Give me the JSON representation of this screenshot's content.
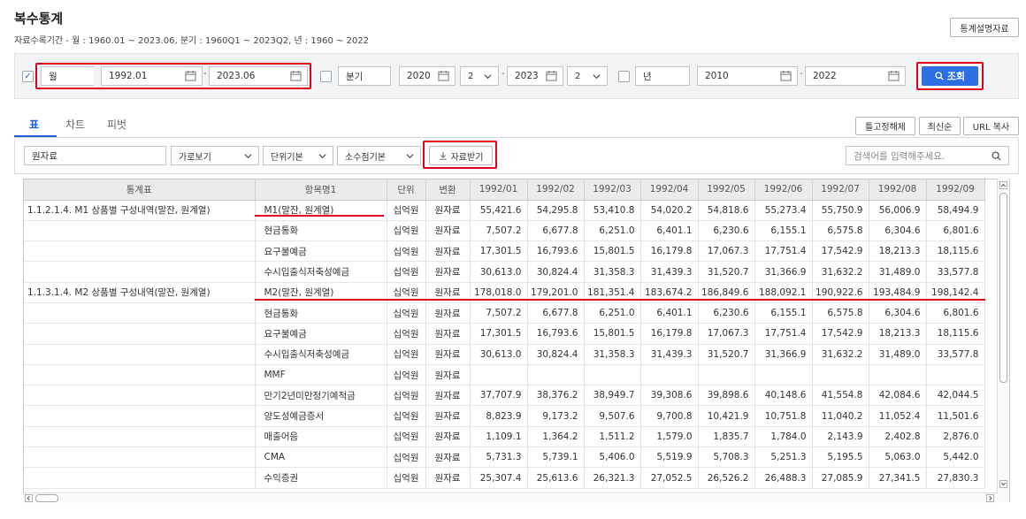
{
  "page": {
    "title": "복수통계",
    "subtitle": "자료수록기간 - 월 : 1960.01 ~ 2023.06, 분기 : 1960Q1 ~ 2023Q2, 년 : 1960 ~ 2022",
    "help_button": "통계설명자료"
  },
  "search": {
    "monthly": {
      "label": "월",
      "checked": true,
      "from": "1992.01",
      "to": "2023.06"
    },
    "quarterly": {
      "label": "분기",
      "checked": false,
      "from_year": "2020",
      "from_q": "2",
      "to_year": "2023",
      "to_q": "2"
    },
    "yearly": {
      "label": "년",
      "checked": false,
      "from": "2010",
      "to": "2022"
    },
    "dash": "-",
    "search_button": "조회"
  },
  "tabs": [
    {
      "label": "표",
      "active": true
    },
    {
      "label": "차트",
      "active": false
    },
    {
      "label": "피벗",
      "active": false
    }
  ],
  "top_actions": {
    "unfreeze": "틀고정해제",
    "latest": "최신순",
    "url_copy": "URL 복사"
  },
  "toolbar": {
    "raw_data": "원자료",
    "view": "가로보기",
    "unit": "단위기본",
    "decimal": "소수점기본",
    "download": "자료받기",
    "search_placeholder": "검색어를 입력해주세요."
  },
  "table": {
    "columns": [
      "통계표",
      "항목명1",
      "단위",
      "변환",
      "1992/01",
      "1992/02",
      "1992/03",
      "1992/04",
      "1992/05",
      "1992/06",
      "1992/07",
      "1992/08",
      "1992/09"
    ],
    "rows": [
      {
        "table": "1.1.2.1.4. M1 상품별 구성내역(말잔, 원계열)",
        "item": "M1(말잔, 원계열)",
        "unit": "십억원",
        "conv": "원자료",
        "values": [
          "55,421.6",
          "54,295.8",
          "53,410.8",
          "54,020.2",
          "54,818.6",
          "55,273.4",
          "55,750.9",
          "56,006.9",
          "58,494.9"
        ]
      },
      {
        "table": "",
        "item": "현금통화",
        "unit": "십억원",
        "conv": "원자료",
        "values": [
          "7,507.2",
          "6,677.8",
          "6,251.0",
          "6,401.1",
          "6,230.6",
          "6,155.1",
          "6,575.8",
          "6,304.6",
          "6,801.6"
        ]
      },
      {
        "table": "",
        "item": "요구불예금",
        "unit": "십억원",
        "conv": "원자료",
        "values": [
          "17,301.5",
          "16,793.6",
          "15,801.5",
          "16,179.8",
          "17,067.3",
          "17,751.4",
          "17,542.9",
          "18,213.3",
          "18,115.6"
        ]
      },
      {
        "table": "",
        "item": "수시입출식저축성예금",
        "unit": "십억원",
        "conv": "원자료",
        "values": [
          "30,613.0",
          "30,824.4",
          "31,358.3",
          "31,439.3",
          "31,520.7",
          "31,366.9",
          "31,632.2",
          "31,489.0",
          "33,577.8"
        ]
      },
      {
        "table": "1.1.3.1.4. M2 상품별 구성내역(말잔, 원계열)",
        "item": "M2(말잔, 원계열)",
        "unit": "십억원",
        "conv": "원자료",
        "values": [
          "178,018.0",
          "179,201.0",
          "181,351.4",
          "183,674.2",
          "186,849.6",
          "188,092.1",
          "190,922.6",
          "193,484.9",
          "198,142.4"
        ]
      },
      {
        "table": "",
        "item": "현금통화",
        "unit": "십억원",
        "conv": "원자료",
        "values": [
          "7,507.2",
          "6,677.8",
          "6,251.0",
          "6,401.1",
          "6,230.6",
          "6,155.1",
          "6,575.8",
          "6,304.6",
          "6,801.6"
        ]
      },
      {
        "table": "",
        "item": "요구불예금",
        "unit": "십억원",
        "conv": "원자료",
        "values": [
          "17,301.5",
          "16,793.6",
          "15,801.5",
          "16,179.8",
          "17,067.3",
          "17,751.4",
          "17,542.9",
          "18,213.3",
          "18,115.6"
        ]
      },
      {
        "table": "",
        "item": "수시입출식저축성예금",
        "unit": "십억원",
        "conv": "원자료",
        "values": [
          "30,613.0",
          "30,824.4",
          "31,358.3",
          "31,439.3",
          "31,520.7",
          "31,366.9",
          "31,632.2",
          "31,489.0",
          "33,577.8"
        ]
      },
      {
        "table": "",
        "item": "MMF",
        "unit": "십억원",
        "conv": "원자료",
        "values": [
          "",
          "",
          "",
          "",
          "",
          "",
          "",
          "",
          ""
        ]
      },
      {
        "table": "",
        "item": "만기2년미만정기예적금",
        "unit": "십억원",
        "conv": "원자료",
        "values": [
          "37,707.9",
          "38,376.2",
          "38,949.7",
          "39,308.6",
          "39,898.6",
          "40,148.6",
          "41,554.8",
          "42,084.6",
          "42,044.5"
        ]
      },
      {
        "table": "",
        "item": "양도성예금증서",
        "unit": "십억원",
        "conv": "원자료",
        "values": [
          "8,823.9",
          "9,173.2",
          "9,507.6",
          "9,700.8",
          "10,421.9",
          "10,751.8",
          "11,040.2",
          "11,052.4",
          "11,501.6"
        ]
      },
      {
        "table": "",
        "item": "매출어음",
        "unit": "십억원",
        "conv": "원자료",
        "values": [
          "1,109.1",
          "1,364.2",
          "1,511.2",
          "1,579.0",
          "1,835.7",
          "1,784.0",
          "2,143.9",
          "2,402.8",
          "2,876.0"
        ]
      },
      {
        "table": "",
        "item": "CMA",
        "unit": "십억원",
        "conv": "원자료",
        "values": [
          "5,731.3",
          "5,739.1",
          "5,406.0",
          "5,519.9",
          "5,708.3",
          "5,251.3",
          "5,195.5",
          "5,063.0",
          "5,442.0"
        ]
      },
      {
        "table": "",
        "item": "수익증권",
        "unit": "십억원",
        "conv": "원자료",
        "values": [
          "25,307.4",
          "25,613.6",
          "26,321.3",
          "27,052.5",
          "26,526.2",
          "26,488.3",
          "27,085.9",
          "27,341.5",
          "27,830.3"
        ]
      }
    ]
  },
  "colors": {
    "accent": "#1e5fcf",
    "highlight": "#e0001b",
    "search_button": "#2d6ee3"
  }
}
